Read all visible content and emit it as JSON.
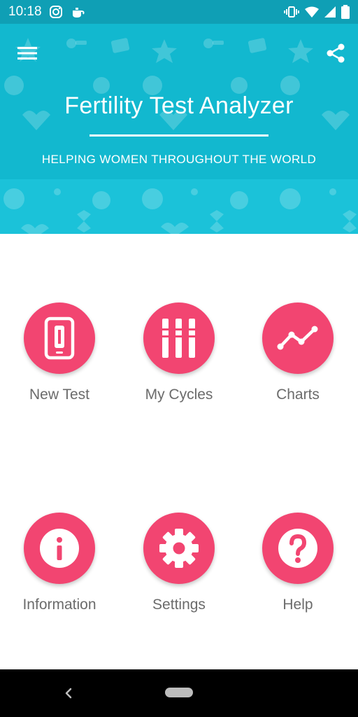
{
  "status_bar": {
    "time": "10:18",
    "icons": [
      "instagram-icon",
      "teapot-icon",
      "vibrate-icon",
      "wifi-icon",
      "signal-icon",
      "battery-icon"
    ]
  },
  "header": {
    "title": "Fertility Test Analyzer",
    "subtitle": "HELPING WOMEN THROUGHOUT THE WORLD",
    "icons": [
      "menu-icon",
      "share-icon"
    ]
  },
  "colors": {
    "status_bar": "#0f9fb5",
    "header": "#1bc2d9",
    "accent": "#f24571",
    "label": "#6b6b6b"
  },
  "menu": [
    {
      "label": "New Test",
      "icon": "phone-test-icon"
    },
    {
      "label": "My Cycles",
      "icon": "test-strips-icon"
    },
    {
      "label": "Charts",
      "icon": "line-chart-icon"
    },
    {
      "label": "Information",
      "icon": "info-icon"
    },
    {
      "label": "Settings",
      "icon": "gear-icon"
    },
    {
      "label": "Help",
      "icon": "help-icon"
    }
  ]
}
